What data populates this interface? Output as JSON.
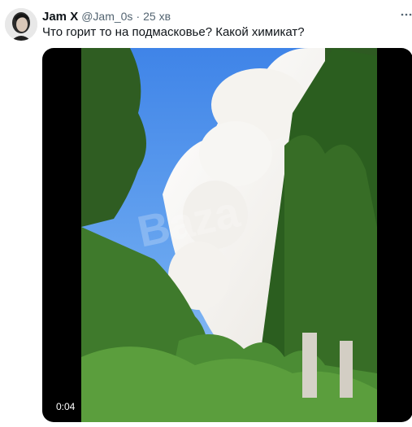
{
  "tweet": {
    "author": {
      "display_name": "Jam X",
      "handle": "@Jam_0s",
      "separator": "·",
      "time": "25 хв",
      "avatar_icon": "woman-portrait-avatar"
    },
    "more_icon": "more-options-icon",
    "text": "Что горит то на подмасковье? Какой химикат?",
    "media": {
      "type": "video",
      "duration": "0:04",
      "description_icon": "smoke-plume-video-frame",
      "watermark": "Baza"
    }
  }
}
